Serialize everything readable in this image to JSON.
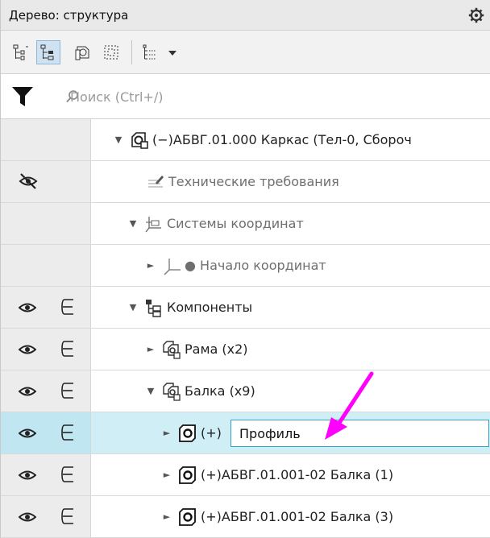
{
  "panel": {
    "title": "Дерево: структура"
  },
  "toolbar": {
    "buttons": [
      {
        "icon": "tree-view-icon",
        "active": false
      },
      {
        "icon": "structure-view-icon",
        "active": true
      },
      {
        "icon": "body-view-icon",
        "active": false
      },
      {
        "icon": "select-region-icon",
        "active": false
      },
      {
        "icon": "filter-list-icon",
        "active": false
      },
      {
        "icon": "chevron-down-icon",
        "active": false
      }
    ]
  },
  "search": {
    "placeholder": "Поиск (Ctrl+/)"
  },
  "tree": {
    "rows": [
      {
        "label": "(−)АБВГ.01.000 Каркас (Тел-0, Сбороч",
        "icon": "assembly-icon"
      },
      {
        "label": "Технические требования",
        "icon": "technical-requirements-icon"
      },
      {
        "label": "Системы координат",
        "icon": "coordinate-systems-icon"
      },
      {
        "label": "● Начало координат",
        "icon": "origin-icon"
      },
      {
        "label": "Компоненты",
        "icon": "components-icon"
      },
      {
        "label": "Рама (x2)",
        "icon": "part-group-icon"
      },
      {
        "label": "Балка (x9)",
        "icon": "part-group-icon"
      },
      {
        "prefix": "(+)",
        "edit_value": "Профиль",
        "icon": "part-icon"
      },
      {
        "label": "(+)АБВГ.01.001-02 Балка (1)",
        "icon": "part-icon"
      },
      {
        "label": "(+)АБВГ.01.001-02 Балка (3)",
        "icon": "part-icon"
      }
    ]
  },
  "colors": {
    "selection": "#cfeef6",
    "arrow": "#ff00ff",
    "edit_border": "#3aa0c4"
  }
}
